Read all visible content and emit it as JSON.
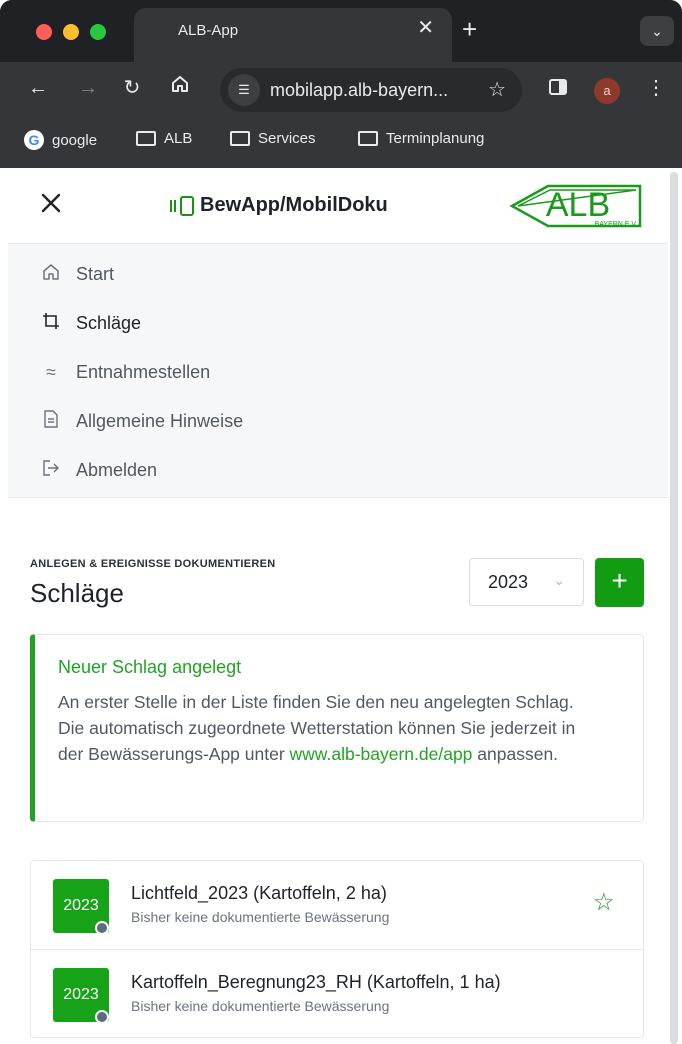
{
  "browser": {
    "tab_title": "ALB-App",
    "tab_close": "✕",
    "new_tab": "+",
    "tab_menu": "⌄",
    "url": "mobilapp.alb-bayern...",
    "profile_initial": "a",
    "bookmarks": [
      "google",
      "ALB",
      "Services",
      "Terminplanung"
    ]
  },
  "app": {
    "brand": "BewApp/MobilDoku",
    "logo_text": "ALB",
    "logo_sub": "BAYERN E.V.",
    "close_icon": "close-icon"
  },
  "menu": {
    "items": [
      {
        "label": "Start",
        "icon": "home-icon"
      },
      {
        "label": "Schläge",
        "icon": "crop-icon"
      },
      {
        "label": "Entnahmestellen",
        "icon": "water-icon"
      },
      {
        "label": "Allgemeine Hinweise",
        "icon": "document-icon"
      },
      {
        "label": "Abmelden",
        "icon": "logout-icon"
      }
    ]
  },
  "section": {
    "kicker": "ANLEGEN & EREIGNISSE DOKUMENTIEREN",
    "title": "Schläge",
    "year": "2023",
    "add_label": "+"
  },
  "notice": {
    "title": "Neuer Schlag angelegt",
    "body_before": "An erster Stelle in der Liste finden Sie den neu angelegten Schlag. Die automatisch zugeordnete Wetterstation können Sie jederzeit in der Bewässerungs-App unter ",
    "link": "www.alb-bayern.de/app",
    "body_after": " anpassen."
  },
  "fields": [
    {
      "badge": "2023",
      "title": "Lichtfeld_2023 (Kartoffeln, 2 ha)",
      "subtitle": "Bisher keine dokumentierte Bewässerung",
      "favorite": true
    },
    {
      "badge": "2023",
      "title": "Kartoffeln_Beregnung23_RH (Kartoffeln, 1 ha)",
      "subtitle": "Bisher keine dokumentierte Bewässerung",
      "favorite": false
    }
  ],
  "colors": {
    "accent_green": "#129c12",
    "chrome_dark": "#35363a"
  }
}
